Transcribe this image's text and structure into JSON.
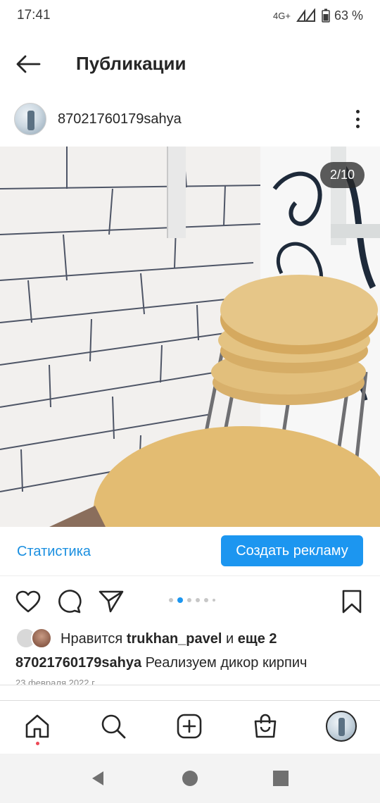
{
  "status_bar": {
    "time": "17:41",
    "network": "4G+",
    "battery": "63 %"
  },
  "header": {
    "title": "Публикации"
  },
  "post": {
    "username": "87021760179sahya",
    "image_counter": "2/10",
    "carousel": {
      "total": 6,
      "active_index": 1
    }
  },
  "promo": {
    "stats_label": "Статистика",
    "ad_button_label": "Создать рекламу"
  },
  "likes": {
    "prefix": "Нравится",
    "user": "trukhan_pavel",
    "middle": "и",
    "others": "еще 2"
  },
  "caption": {
    "username": "87021760179sahya",
    "text": "Реализуем дикор кирпич"
  },
  "date": "23 февраля 2022 г.",
  "colors": {
    "accent": "#1c96f0",
    "link": "#1a8fe0",
    "notification": "#ed4956"
  },
  "icons": {
    "back": "arrow-left-icon",
    "more": "more-vertical-icon",
    "like": "heart-icon",
    "comment": "comment-icon",
    "share": "send-icon",
    "save": "bookmark-icon",
    "home": "home-icon",
    "search": "search-icon",
    "create": "plus-square-icon",
    "shop": "shopping-bag-icon",
    "profile": "profile-avatar"
  }
}
